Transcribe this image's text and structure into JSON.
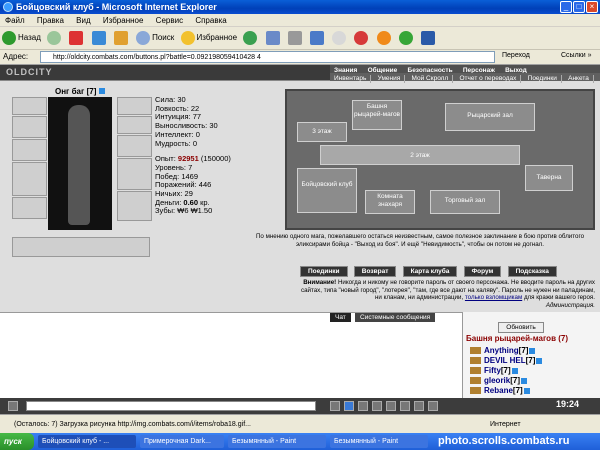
{
  "window": {
    "title": "Бойцовский клуб - Microsoft Internet Explorer"
  },
  "menu": [
    "Файл",
    "Правка",
    "Вид",
    "Избранное",
    "Сервис",
    "Справка"
  ],
  "toolbar": {
    "back": "Назад",
    "search": "Поиск",
    "favorites": "Избранное"
  },
  "address": {
    "label": "Адрес:",
    "url": "http://oldcity.combats.com/buttons.pl?battle=0.092198059410428 4",
    "go": "Переход",
    "links": "Ссылки »"
  },
  "site": {
    "logo": "OLDCITY",
    "nav_top": [
      "Знания",
      "Общение",
      "Безопасность",
      "Персонаж",
      "Выход"
    ],
    "nav_sub": [
      "Инвентарь",
      "Умения",
      "Мой Скролл",
      "Отчет о переводах",
      "Поединки",
      "Анкета"
    ]
  },
  "character": {
    "name": "Онг баг",
    "level": "[7]",
    "stats": [
      {
        "label": "Сила:",
        "value": "30"
      },
      {
        "label": "Ловкость:",
        "value": "22"
      },
      {
        "label": "Интуиция:",
        "value": "77"
      },
      {
        "label": "Выносливость:",
        "value": "30"
      },
      {
        "label": "Интеллект:",
        "value": "0"
      },
      {
        "label": "Мудрость:",
        "value": "0"
      }
    ],
    "exp_label": "Опыт:",
    "exp_value": "92951",
    "exp_next": "(150000)",
    "level_label": "Уровень:",
    "level_value": "7",
    "wins_label": "Побед:",
    "wins_value": "1469",
    "losses_label": "Поражений:",
    "losses_value": "446",
    "draws_label": "Ничьих:",
    "draws_value": "29",
    "money_label": "Деньги:",
    "money_value": "0.60",
    "money_unit": "кр.",
    "teeth_label": "Зубы:",
    "teeth_value": "₩6 ₩1.50"
  },
  "map": {
    "rooms": [
      "Башня рыцарей-магов",
      "Рыцарский зал",
      "3 этаж",
      "2 этаж",
      "Таверна",
      "Бойцовский клуб",
      "Комната знахаря",
      "Торговый зал"
    ]
  },
  "description": "По мнению одного мага, пожелавшего остаться неизвестным, самое полезное заклинание в бою против облитого эликсирами бойца - \"Выход из боя\". И ещё \"Невидимость\", чтобы он потом не догнал.",
  "actions": [
    "Поединки",
    "Возврат",
    "Карта клуба",
    "Форум",
    "Подсказка"
  ],
  "warning": {
    "bold": "Внимание!",
    "text": "Никогда и никому не говорите пароль от своего персонажа. Не вводите пароль на других сайтах, типа \"новый город\", \"лотерея\", \"там, где все дают на халяву\". Пароль не нужен ни паладинам, ни кланам, ни администрации,",
    "link": "только взломщикам",
    "tail": "для кражи вашего героя.",
    "sign": "Администрация."
  },
  "chat": {
    "tabs": [
      "Чат",
      "Системные сообщения"
    ]
  },
  "sidebar": {
    "refresh": "Обновить",
    "room": "Башня рыцарей-магов (7)",
    "users": [
      {
        "name": "Anything",
        "level": "[7]"
      },
      {
        "name": "DEVIL HEL",
        "level": "[7]"
      },
      {
        "name": "Fifty",
        "level": "[7]"
      },
      {
        "name": "gleorik",
        "level": "[7]"
      },
      {
        "name": "Rebane",
        "level": "[7]"
      }
    ]
  },
  "chatbar": {
    "time": "19:24"
  },
  "status": {
    "text": "(Осталось: 7) Загрузка рисунка http://img.combats.com/i/items/roba18.gif...",
    "zone": "Интернет"
  },
  "taskbar": {
    "start": "пуск",
    "tasks": [
      "Бойцовский клуб - ...",
      "Примерочная Dark...",
      "Безымянный - Paint",
      "Безымянный - Paint"
    ],
    "watermark": "photo.scrolls.combats.ru"
  }
}
